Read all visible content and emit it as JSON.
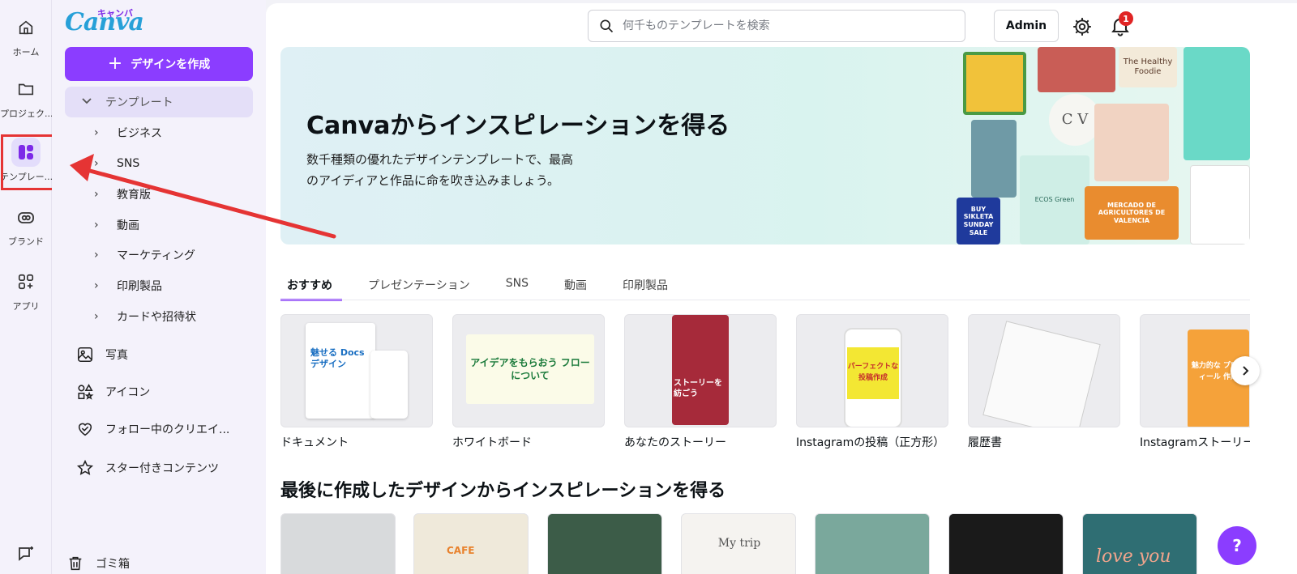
{
  "rail": {
    "items": [
      {
        "label": "ホーム",
        "icon": "home-icon"
      },
      {
        "label": "プロジェク...",
        "icon": "folder-icon"
      },
      {
        "label": "テンプレー...",
        "icon": "template-icon"
      },
      {
        "label": "ブランド",
        "icon": "brand-icon"
      },
      {
        "label": "アプリ",
        "icon": "apps-icon"
      }
    ]
  },
  "sidebar": {
    "logo": "Canva",
    "logo_kana": "キャンバ",
    "create_label": "デザインを作成",
    "templates_label": "テンプレート",
    "template_children": [
      "ビジネス",
      "SNS",
      "教育版",
      "動画",
      "マーケティング",
      "印刷製品",
      "カードや招待状"
    ],
    "nav": [
      {
        "label": "写真",
        "icon": "photo-icon"
      },
      {
        "label": "アイコン",
        "icon": "shapes-icon"
      },
      {
        "label": "フォロー中のクリエイ...",
        "icon": "heart-icon"
      },
      {
        "label": "スター付きコンテンツ",
        "icon": "star-icon"
      }
    ],
    "trash_label": "ゴミ箱"
  },
  "header": {
    "search_placeholder": "何千ものテンプレートを検索",
    "admin_label": "Admin",
    "notification_count": "1"
  },
  "banner": {
    "title": "Canvaからインスピレーションを得る",
    "description": "数千種類の優れたデザインテンプレートで、最高のアイディアと作品に命を吹き込みましょう。",
    "collage_texts": [
      "The Healthy Foodie",
      "C V",
      "MERCADO DE AGRICULTORES DE VALENCIA",
      "BUY SIKLETA SUNDAY SALE",
      "ECOS Green"
    ]
  },
  "tabs": [
    "おすすめ",
    "プレゼンテーション",
    "SNS",
    "動画",
    "印刷製品"
  ],
  "tiles": [
    {
      "caption": "ドキュメント",
      "thumb_text": "魅せる Docsデザイン"
    },
    {
      "caption": "ホワイトボード",
      "thumb_text": "アイデアをもらおう フローについて"
    },
    {
      "caption": "あなたのストーリー",
      "thumb_text": "ストーリーを紡ごう"
    },
    {
      "caption": "Instagramの投稿（正方形）",
      "thumb_text": "パーフェクトな 投稿作成"
    },
    {
      "caption": "履歴書",
      "thumb_text": ""
    },
    {
      "caption": "Instagramストーリー",
      "thumb_text": "魅力的な プロフィール 作成"
    }
  ],
  "recent_section_title": "最後に作成したデザインからインスピレーションを得る",
  "recent_texts": [
    "CAFE",
    "My trip",
    "love you"
  ],
  "help_label": "?",
  "colors": {
    "accent": "#8b3dff",
    "annotation": "#e53434"
  }
}
